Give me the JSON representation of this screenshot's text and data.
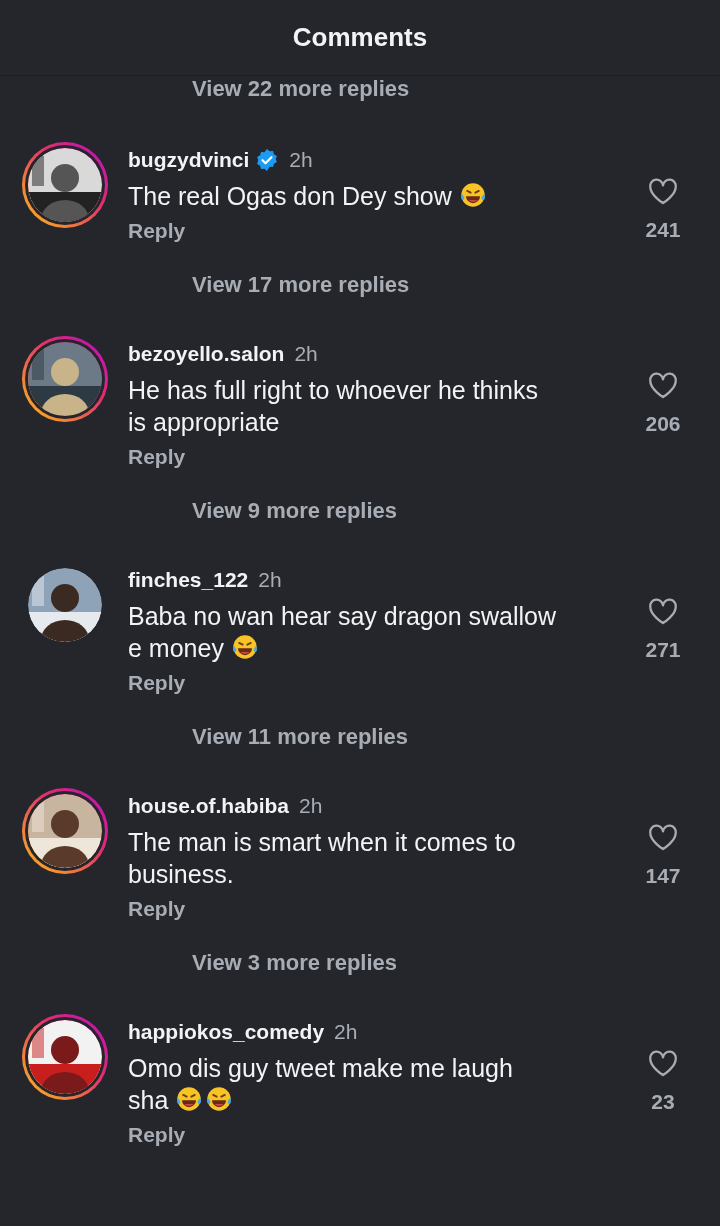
{
  "header": {
    "title": "Comments"
  },
  "top_more_replies": "View 22 more replies",
  "comments": [
    {
      "username": "bugzydvinci",
      "verified": true,
      "has_story": true,
      "time": "2h",
      "text": "The real Ogas don Dey show",
      "emojis": [
        {
          "kind": "laughing"
        }
      ],
      "reply": "Reply",
      "likes": "241",
      "more_replies": "View 17 more replies"
    },
    {
      "username": "bezoyello.salon",
      "verified": false,
      "has_story": true,
      "time": "2h",
      "text": "He has full right to whoever he thinks is appropriate",
      "reply": "Reply",
      "likes": "206",
      "more_replies": "View 9 more replies"
    },
    {
      "username": "finches_122",
      "verified": false,
      "has_story": false,
      "time": "2h",
      "text": "Baba no wan hear say dragon swallow e money",
      "emojis": [
        {
          "kind": "laughing"
        }
      ],
      "reply": "Reply",
      "likes": "271",
      "more_replies": "View 11 more replies"
    },
    {
      "username": "house.of.habiba",
      "verified": false,
      "has_story": true,
      "time": "2h",
      "text": "The man is smart when it comes to business.",
      "reply": "Reply",
      "likes": "147",
      "more_replies": "View 3 more replies"
    },
    {
      "username": "happiokos_comedy",
      "verified": false,
      "has_story": true,
      "time": "2h",
      "text": "Omo dis guy tweet make me laugh sha",
      "emojis": [
        {
          "kind": "laughing"
        },
        {
          "kind": "laughing"
        }
      ],
      "reply": "Reply",
      "likes": "23"
    }
  ]
}
